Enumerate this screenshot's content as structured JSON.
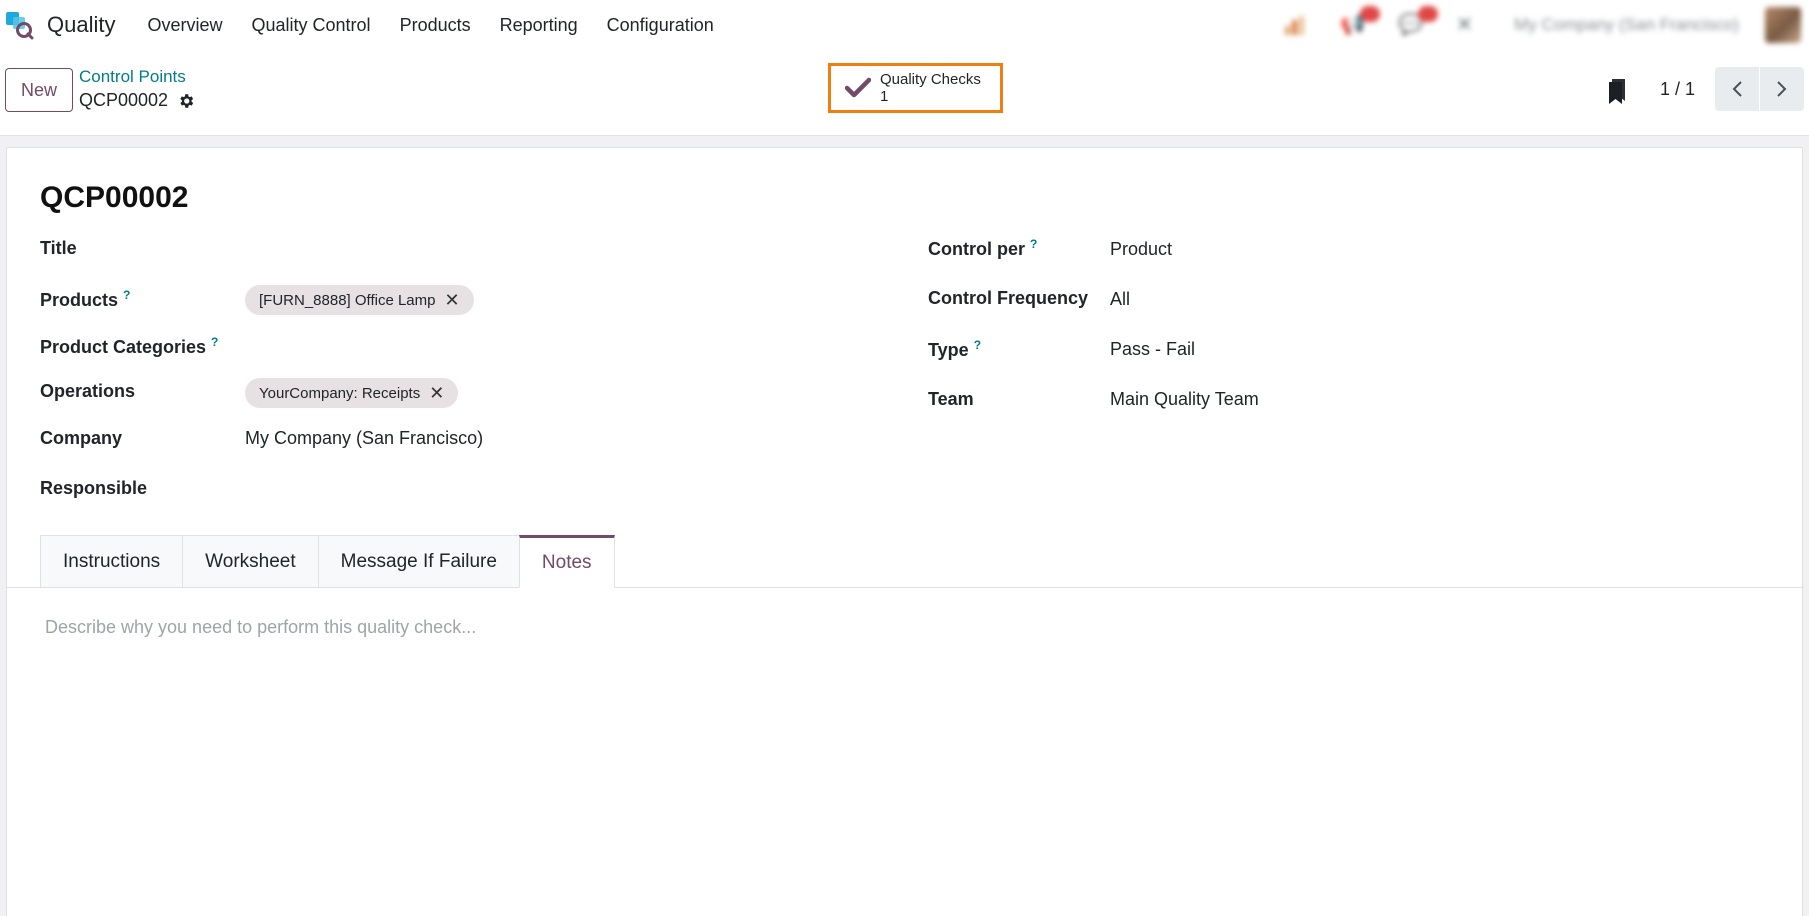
{
  "topnav": {
    "app_name": "Quality",
    "menu": [
      "Overview",
      "Quality Control",
      "Products",
      "Reporting",
      "Configuration"
    ],
    "company": "My Company (San Francisco)",
    "icons": [
      "activity-icon",
      "discuss-icon",
      "chat-icon",
      "company-switch-icon"
    ]
  },
  "control_panel": {
    "new_label": "New",
    "breadcrumb": "Control Points",
    "record_name": "QCP00002",
    "smart_button": {
      "label": "Quality Checks",
      "value": "1"
    },
    "pager": "1 / 1"
  },
  "form": {
    "title": "QCP00002",
    "fields_left": {
      "title_label": "Title",
      "products_label": "Products",
      "products_help": "?",
      "products_tag": "[FURN_8888] Office Lamp",
      "categories_label": "Product Categories",
      "categories_help": "?",
      "operations_label": "Operations",
      "operations_tag": "YourCompany: Receipts",
      "company_label": "Company",
      "company_value": "My Company (San Francisco)",
      "responsible_label": "Responsible"
    },
    "fields_right": {
      "control_per_label": "Control per",
      "control_per_help": "?",
      "control_per_value": "Product",
      "frequency_label": "Control Frequency",
      "frequency_value": "All",
      "type_label": "Type",
      "type_help": "?",
      "type_value": "Pass - Fail",
      "team_label": "Team",
      "team_value": "Main Quality Team"
    },
    "tabs": [
      "Instructions",
      "Worksheet",
      "Message If Failure",
      "Notes"
    ],
    "active_tab": "Notes",
    "notes_placeholder": "Describe why you need to perform this quality check..."
  },
  "colors": {
    "brand": "#714b67",
    "link": "#017e84",
    "highlight": "#f07f12"
  }
}
